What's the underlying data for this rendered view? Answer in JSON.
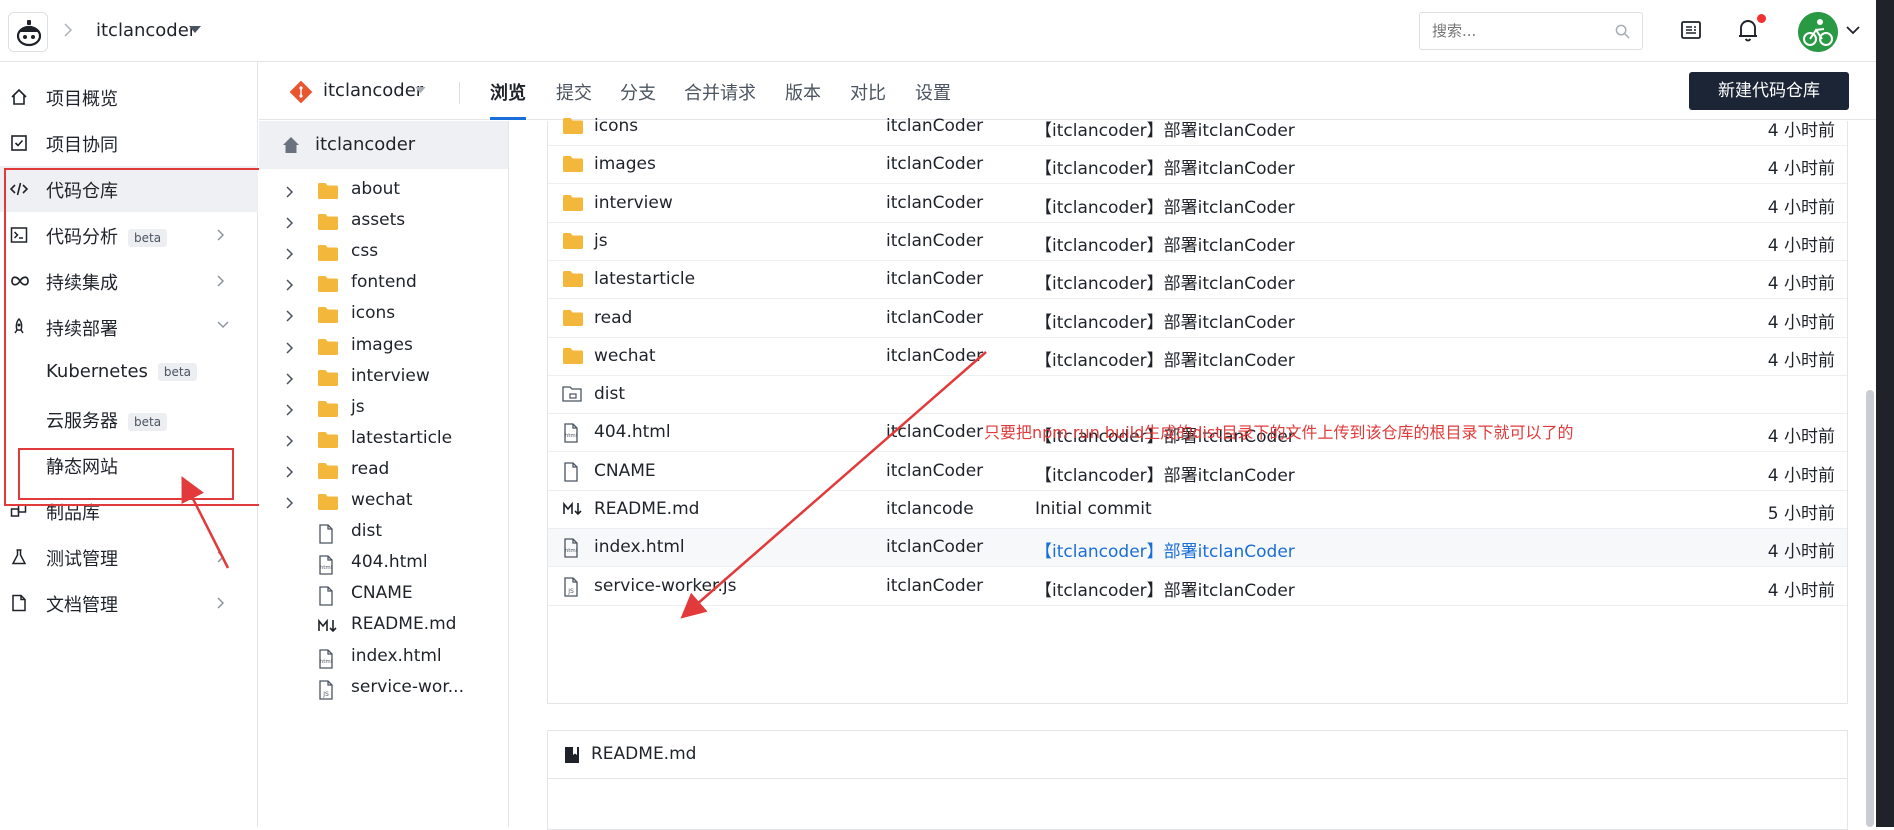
{
  "topbar": {
    "project": "itclancoder",
    "search_placeholder": "搜索..."
  },
  "sidebar": {
    "items": [
      {
        "label": "项目概览",
        "icon": "home-icon"
      },
      {
        "label": "项目协同",
        "icon": "checkbox-icon"
      },
      {
        "label": "代码仓库",
        "icon": "code-icon"
      },
      {
        "label": "代码分析",
        "icon": "terminal-icon",
        "badge": "beta"
      },
      {
        "label": "持续集成",
        "icon": "infinity-icon"
      },
      {
        "label": "持续部署",
        "icon": "rocket-icon"
      },
      {
        "label": "Kubernetes",
        "badge": "beta"
      },
      {
        "label": "云服务器",
        "badge": "beta"
      },
      {
        "label": "静态网站"
      },
      {
        "label": "制品库",
        "icon": "package-icon"
      },
      {
        "label": "测试管理",
        "icon": "flask-icon"
      },
      {
        "label": "文档管理",
        "icon": "document-icon"
      }
    ]
  },
  "repo": {
    "name": "itclancoder",
    "tabs": [
      "浏览",
      "提交",
      "分支",
      "合并请求",
      "版本",
      "对比",
      "设置"
    ],
    "new_button": "新建代码仓库"
  },
  "tree": {
    "root": "itclancoder",
    "items": [
      {
        "name": "about",
        "type": "folder"
      },
      {
        "name": "assets",
        "type": "folder"
      },
      {
        "name": "css",
        "type": "folder"
      },
      {
        "name": "fontend",
        "type": "folder"
      },
      {
        "name": "icons",
        "type": "folder"
      },
      {
        "name": "images",
        "type": "folder"
      },
      {
        "name": "interview",
        "type": "folder"
      },
      {
        "name": "js",
        "type": "folder"
      },
      {
        "name": "latestarticle",
        "type": "folder"
      },
      {
        "name": "read",
        "type": "folder"
      },
      {
        "name": "wechat",
        "type": "folder"
      },
      {
        "name": "dist",
        "type": "file"
      },
      {
        "name": "404.html",
        "type": "html"
      },
      {
        "name": "CNAME",
        "type": "file"
      },
      {
        "name": "README.md",
        "type": "md"
      },
      {
        "name": "index.html",
        "type": "html"
      },
      {
        "name": "service-wor...",
        "type": "js"
      }
    ]
  },
  "files": [
    {
      "name": "icons",
      "type": "folder",
      "author": "itclanCoder",
      "message": "【itclancoder】部署itclanCoder",
      "time": "4 小时前"
    },
    {
      "name": "images",
      "type": "folder",
      "author": "itclanCoder",
      "message": "【itclancoder】部署itclanCoder",
      "time": "4 小时前"
    },
    {
      "name": "interview",
      "type": "folder",
      "author": "itclanCoder",
      "message": "【itclancoder】部署itclanCoder",
      "time": "4 小时前"
    },
    {
      "name": "js",
      "type": "folder",
      "author": "itclanCoder",
      "message": "【itclancoder】部署itclanCoder",
      "time": "4 小时前"
    },
    {
      "name": "latestarticle",
      "type": "folder",
      "author": "itclanCoder",
      "message": "【itclancoder】部署itclanCoder",
      "time": "4 小时前"
    },
    {
      "name": "read",
      "type": "folder",
      "author": "itclanCoder",
      "message": "【itclancoder】部署itclanCoder",
      "time": "4 小时前"
    },
    {
      "name": "wechat",
      "type": "folder",
      "author": "itclanCoder",
      "message": "【itclancoder】部署itclanCoder",
      "time": "4 小时前"
    },
    {
      "name": "dist",
      "type": "submodule",
      "author": "",
      "message": "",
      "time": ""
    },
    {
      "name": "404.html",
      "type": "html",
      "author": "itclanCoder",
      "message": "【itclancoder】部署itclanCoder",
      "time": "4 小时前"
    },
    {
      "name": "CNAME",
      "type": "file",
      "author": "itclanCoder",
      "message": "【itclancoder】部署itclanCoder",
      "time": "4 小时前"
    },
    {
      "name": "README.md",
      "type": "md",
      "author": "itclancode",
      "message": "Initial commit",
      "time": "5 小时前"
    },
    {
      "name": "index.html",
      "type": "html",
      "author": "itclanCoder",
      "message": "【itclancoder】部署itclanCoder",
      "time": "4 小时前",
      "highlight": true
    },
    {
      "name": "service-worker.js",
      "type": "js",
      "author": "itclanCoder",
      "message": "【itclancoder】部署itclanCoder",
      "time": "4 小时前"
    }
  ],
  "readme": {
    "title": "README.md"
  },
  "annotation": {
    "text": "只要把npm run build生成的dist目录下的文件上传到该仓库的根目录下就可以了的",
    "color": "#e23a3a"
  },
  "colors": {
    "accent": "#1a6ed8",
    "folder": "#f2b73b",
    "button": "#1c2535",
    "annotation": "#e23a3a"
  }
}
